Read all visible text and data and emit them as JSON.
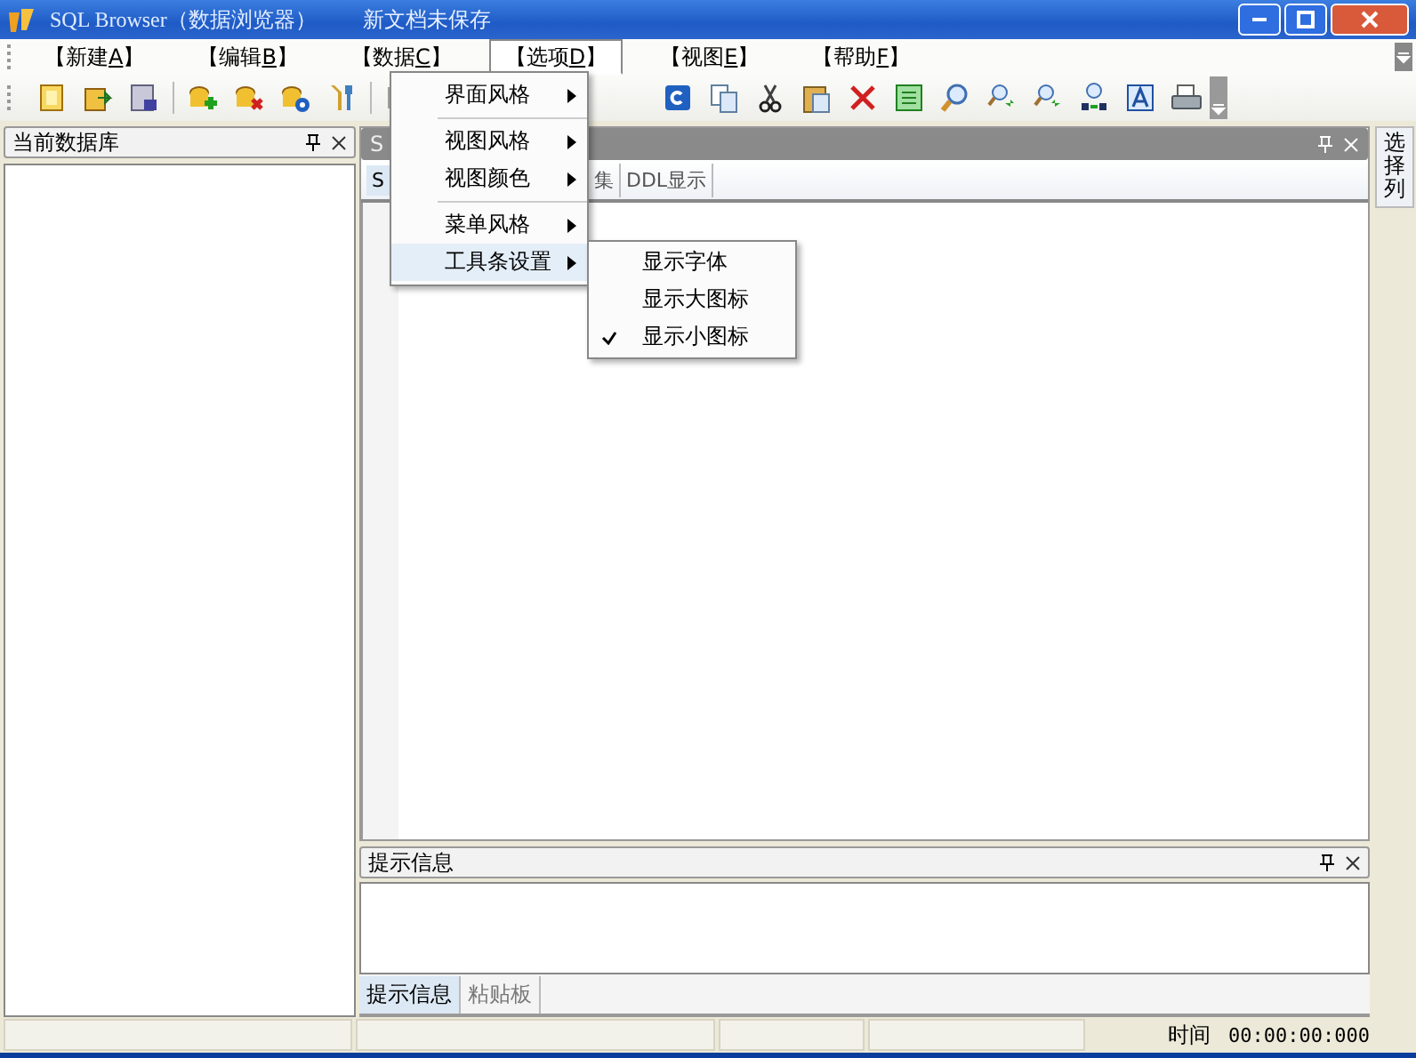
{
  "window": {
    "title": "SQL Browser（数据浏览器）",
    "document": "新文档未保存"
  },
  "menu_bar": [
    {
      "prefix": "【新建",
      "accel": "A",
      "suffix": "】",
      "selected": false
    },
    {
      "prefix": "【编辑",
      "accel": "B",
      "suffix": "】",
      "selected": false
    },
    {
      "prefix": "【数据",
      "accel": "C",
      "suffix": "】",
      "selected": false
    },
    {
      "prefix": "【选项",
      "accel": "D",
      "suffix": "】",
      "selected": true
    },
    {
      "prefix": "【视图",
      "accel": "E",
      "suffix": "】",
      "selected": false
    },
    {
      "prefix": "【帮助",
      "accel": "F",
      "suffix": "】",
      "selected": false
    }
  ],
  "open_menu": [
    {
      "label": "界面风格",
      "separator_after": true,
      "selected": false
    },
    {
      "label": "视图风格",
      "separator_after": false,
      "selected": false
    },
    {
      "label": "视图颜色",
      "separator_after": true,
      "selected": false
    },
    {
      "label": "菜单风格",
      "separator_after": false,
      "selected": false
    },
    {
      "label": "工具条设置",
      "separator_after": false,
      "selected": true
    }
  ],
  "submenu": [
    {
      "label": "显示字体",
      "checked": false
    },
    {
      "label": "显示大图标",
      "checked": false
    },
    {
      "label": "显示小图标",
      "checked": true
    }
  ],
  "left_panel": {
    "title": "当前数据库"
  },
  "center_panel": {
    "title": "S",
    "tabs": [
      {
        "label": "S",
        "selected": true
      },
      {
        "label": "集",
        "selected": false
      },
      {
        "label": "DDL显示",
        "selected": false
      }
    ]
  },
  "bottom_panel": {
    "title": "提示信息",
    "tabs": [
      {
        "label": "提示信息",
        "selected": true
      },
      {
        "label": "粘贴板",
        "selected": false
      }
    ]
  },
  "right_strip": {
    "tab": "选择列"
  },
  "status_bar": {
    "label": "时间",
    "value": "00:00:00:000"
  }
}
